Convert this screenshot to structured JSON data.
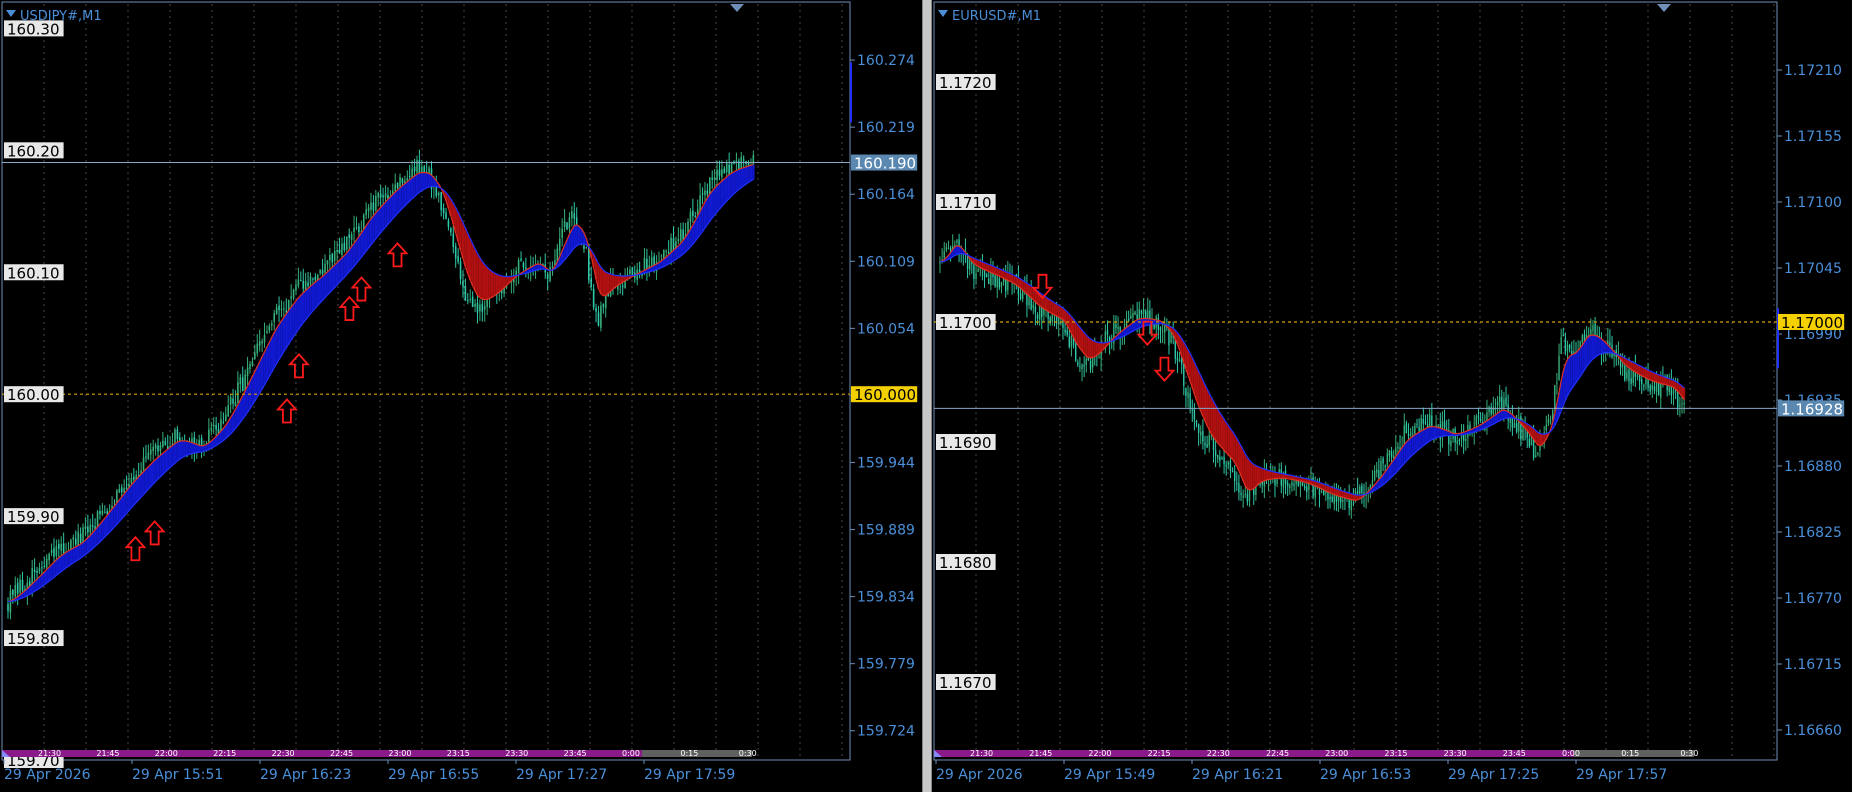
{
  "colors": {
    "background": "#000000",
    "frame": "#6e8fb8",
    "grid": "#4a4a4a",
    "axis_text": "#4a8fd8",
    "bull_candle": "#36b07a",
    "bear_candle": "#2ec9a8",
    "ma_bull_fill": "#1018d0",
    "ma_bear_fill": "#b01010",
    "ma_line": "#e03020",
    "signal_arrow": "#ff1a1a",
    "bid_line": "#8aa8c8",
    "level_line": "#d4a000",
    "timeline_bar": "#8a1a8a",
    "bid_badge": "#5b88b0",
    "level_badge": "#f4d000"
  },
  "chart_data": [
    {
      "type": "candlestick",
      "title": "USDJPY#,M1",
      "ylim": [
        159.7,
        160.32
      ],
      "yaxis_ticks": [
        "160.274",
        "160.219",
        "160.164",
        "160.109",
        "160.054",
        "159.999",
        "159.944",
        "159.889",
        "159.834",
        "159.779",
        "159.724"
      ],
      "yaxis_tick_values": [
        160.274,
        160.219,
        160.164,
        160.109,
        160.054,
        159.999,
        159.944,
        159.889,
        159.834,
        159.779,
        159.724
      ],
      "level_labels": [
        "160.30",
        "160.20",
        "160.10",
        "160.00",
        "159.90",
        "159.80",
        "159.70"
      ],
      "level_values": [
        160.3,
        160.2,
        160.1,
        160.0,
        159.9,
        159.8,
        159.7
      ],
      "bid_value": 160.19,
      "bid_label": "160.190",
      "horizontal_level": 160.0,
      "horizontal_level_label": "160.000",
      "x_time_labels": [
        "29 Apr 2026",
        "29 Apr 15:51",
        "29 Apr 16:23",
        "29 Apr 16:55",
        "29 Apr 17:27",
        "29 Apr 17:59"
      ],
      "mini_time_labels": [
        "21:30",
        "21:45",
        "22:00",
        "22:15",
        "22:30",
        "22:45",
        "23:00",
        "23:15",
        "23:30",
        "23:45",
        "0:00",
        "0:15",
        "0:30"
      ],
      "price_path": [
        [
          0,
          159.83
        ],
        [
          10,
          159.85
        ],
        [
          20,
          159.87
        ],
        [
          30,
          159.88
        ],
        [
          40,
          159.905
        ],
        [
          50,
          159.93
        ],
        [
          60,
          159.95
        ],
        [
          70,
          159.965
        ],
        [
          80,
          159.955
        ],
        [
          90,
          159.98
        ],
        [
          100,
          160.02
        ],
        [
          110,
          160.06
        ],
        [
          120,
          160.085
        ],
        [
          130,
          160.1
        ],
        [
          140,
          160.12
        ],
        [
          150,
          160.15
        ],
        [
          160,
          160.17
        ],
        [
          170,
          160.185
        ],
        [
          175,
          160.18
        ],
        [
          180,
          160.16
        ],
        [
          185,
          160.12
        ],
        [
          190,
          160.085
        ],
        [
          195,
          160.07
        ],
        [
          200,
          160.08
        ],
        [
          210,
          160.1
        ],
        [
          220,
          160.11
        ],
        [
          225,
          160.095
        ],
        [
          230,
          160.13
        ],
        [
          235,
          160.15
        ],
        [
          240,
          160.12
        ],
        [
          245,
          160.06
        ],
        [
          250,
          160.09
        ],
        [
          260,
          160.1
        ],
        [
          270,
          160.11
        ],
        [
          280,
          160.13
        ],
        [
          290,
          160.17
        ],
        [
          300,
          160.185
        ],
        [
          310,
          160.19
        ]
      ],
      "arrows": [
        {
          "t": 53,
          "price": 159.872,
          "dir": "up"
        },
        {
          "t": 61,
          "price": 159.885,
          "dir": "up"
        },
        {
          "t": 116,
          "price": 159.985,
          "dir": "up"
        },
        {
          "t": 121,
          "price": 160.022,
          "dir": "up"
        },
        {
          "t": 142,
          "price": 160.069,
          "dir": "up"
        },
        {
          "t": 147,
          "price": 160.085,
          "dir": "up"
        },
        {
          "t": 162,
          "price": 160.113,
          "dir": "up"
        }
      ]
    },
    {
      "type": "candlestick",
      "title": "EURUSD#,M1",
      "ylim": [
        1.16635,
        1.17265
      ],
      "yaxis_ticks": [
        "1.17210",
        "1.17155",
        "1.17100",
        "1.17045",
        "1.16990",
        "1.16935",
        "1.16880",
        "1.16825",
        "1.16770",
        "1.16715",
        "1.16660"
      ],
      "yaxis_tick_values": [
        1.1721,
        1.17155,
        1.171,
        1.17045,
        1.1699,
        1.16935,
        1.1688,
        1.16825,
        1.1677,
        1.16715,
        1.1666
      ],
      "level_labels": [
        "1.1720",
        "1.1710",
        "1.1700",
        "1.1690",
        "1.1680",
        "1.1670"
      ],
      "level_values": [
        1.172,
        1.171,
        1.17,
        1.169,
        1.168,
        1.167
      ],
      "bid_value": 1.16928,
      "bid_label": "1.16928",
      "horizontal_level": 1.17,
      "horizontal_level_label": "1.17000",
      "x_time_labels": [
        "29 Apr 2026",
        "29 Apr 15:49",
        "29 Apr 16:21",
        "29 Apr 16:53",
        "29 Apr 17:25",
        "29 Apr 17:57"
      ],
      "mini_time_labels": [
        "21:30",
        "21:45",
        "22:00",
        "22:15",
        "22:30",
        "22:45",
        "23:00",
        "23:15",
        "23:30",
        "23:45",
        "0:00",
        "0:15",
        "0:30"
      ],
      "price_path": [
        [
          0,
          1.1705
        ],
        [
          6,
          1.1707
        ],
        [
          12,
          1.17045
        ],
        [
          20,
          1.1704
        ],
        [
          30,
          1.1703
        ],
        [
          40,
          1.1701
        ],
        [
          50,
          1.17
        ],
        [
          55,
          1.16975
        ],
        [
          60,
          1.16965
        ],
        [
          70,
          1.1699
        ],
        [
          80,
          1.17005
        ],
        [
          90,
          1.17
        ],
        [
          95,
          1.16985
        ],
        [
          100,
          1.1695
        ],
        [
          105,
          1.1692
        ],
        [
          110,
          1.169
        ],
        [
          120,
          1.1688
        ],
        [
          125,
          1.1685
        ],
        [
          130,
          1.1687
        ],
        [
          140,
          1.1687
        ],
        [
          150,
          1.16865
        ],
        [
          160,
          1.16855
        ],
        [
          170,
          1.1685
        ],
        [
          180,
          1.16875
        ],
        [
          190,
          1.16905
        ],
        [
          200,
          1.16915
        ],
        [
          210,
          1.16905
        ],
        [
          220,
          1.16915
        ],
        [
          230,
          1.1693
        ],
        [
          240,
          1.16905
        ],
        [
          245,
          1.1689
        ],
        [
          250,
          1.1692
        ],
        [
          255,
          1.16985
        ],
        [
          260,
          1.16975
        ],
        [
          265,
          1.16995
        ],
        [
          270,
          1.16985
        ],
        [
          280,
          1.1696
        ],
        [
          290,
          1.1695
        ],
        [
          300,
          1.16945
        ],
        [
          305,
          1.16928
        ]
      ],
      "arrows": [
        {
          "t": 42,
          "price": 1.17031,
          "dir": "down"
        },
        {
          "t": 85,
          "price": 1.16992,
          "dir": "down"
        },
        {
          "t": 92,
          "price": 1.16962,
          "dir": "down"
        }
      ]
    }
  ]
}
